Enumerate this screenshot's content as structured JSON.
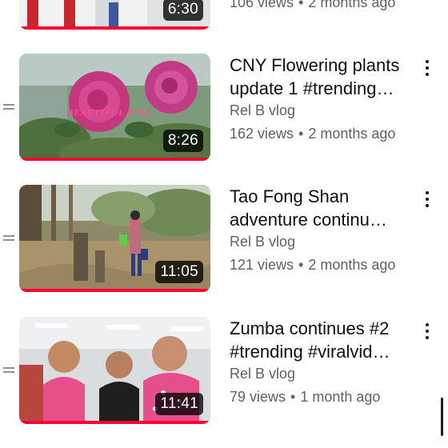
{
  "colors": {
    "accent": "#ff0033",
    "text_primary": "#0f0f0f",
    "text_secondary": "#606060"
  },
  "videos": [
    {
      "title": "",
      "channel": "",
      "views": "106 views",
      "age": "2 months ago",
      "duration": "6:30",
      "watched_fraction": 1.0
    },
    {
      "title": "CNY Flowering plants update 1 #trending…",
      "channel": "Rel B vlog",
      "views": "162 views",
      "age": "2 months ago",
      "duration": "8:26",
      "watched_fraction": 1.0,
      "overlay_text": "BEAUTIFUL PINK"
    },
    {
      "title": "Tao Fong Shan adventure continu…",
      "channel": "Rel B vlog",
      "views": "121 views",
      "age": "2 months ago",
      "duration": "11:05",
      "watched_fraction": 1.0
    },
    {
      "title": "Zumba continues #2 #trending #viralvid…",
      "channel": "Rel B vlog",
      "views": "79 views",
      "age": "1 month ago",
      "duration": "11:41",
      "watched_fraction": 1.0
    }
  ],
  "separator": "•",
  "icons": {
    "drag_handle": "drag-handle-icon",
    "more": "more-vert-icon"
  }
}
